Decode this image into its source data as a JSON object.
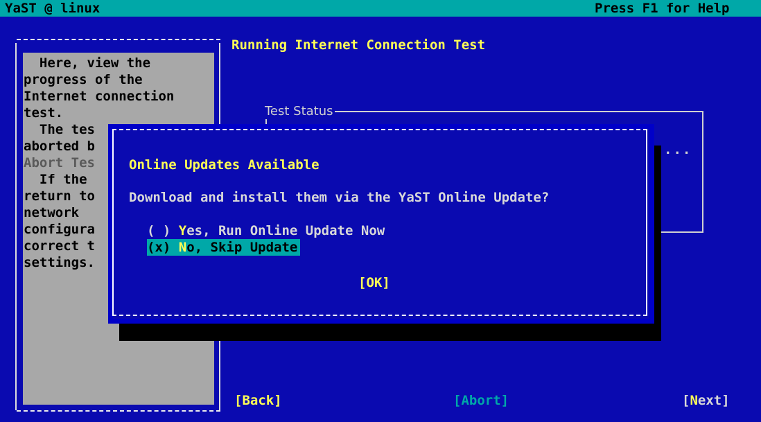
{
  "topbar": {
    "left": "YaST @ linux",
    "right": "Press F1 for Help"
  },
  "help": {
    "lines": [
      {
        "text": "  Here, view the",
        "dim": false
      },
      {
        "text": "progress of the",
        "dim": false
      },
      {
        "text": "Internet connection",
        "dim": false
      },
      {
        "text": "test.",
        "dim": false
      },
      {
        "text": "  The tes",
        "dim": false
      },
      {
        "text": "aborted b",
        "dim": false
      },
      {
        "text": "Abort Tes",
        "dim": true
      },
      {
        "text": "  If the",
        "dim": false
      },
      {
        "text": "return to",
        "dim": false
      },
      {
        "text": "network",
        "dim": false
      },
      {
        "text": "configura",
        "dim": false
      },
      {
        "text": "correct t",
        "dim": false
      },
      {
        "text": "settings.",
        "dim": false
      }
    ]
  },
  "main": {
    "title": "Running Internet Connection Test",
    "status_frame_label": "Test Status",
    "status_dots": "..."
  },
  "popup": {
    "heading": "Online Updates Available",
    "question": "Download and install them via the YaST Online Update?",
    "options": [
      {
        "prefix": "( ) ",
        "hotkey": "Y",
        "rest": "es, Run Online Update Now",
        "selected": false
      },
      {
        "prefix": "(x) ",
        "hotkey": "N",
        "rest": "o, Skip Update",
        "selected": true
      }
    ],
    "ok_label": "[OK]"
  },
  "buttons": {
    "back": "[Back]",
    "abort": "[Abort]",
    "next_open": "[",
    "next_hotkey": "N",
    "next_rest": "ext]"
  },
  "colors": {
    "background": "#0a0ab0",
    "titlebar": "#00a8a8",
    "highlight": "#ffff55",
    "help_panel": "#a8a8a8"
  }
}
